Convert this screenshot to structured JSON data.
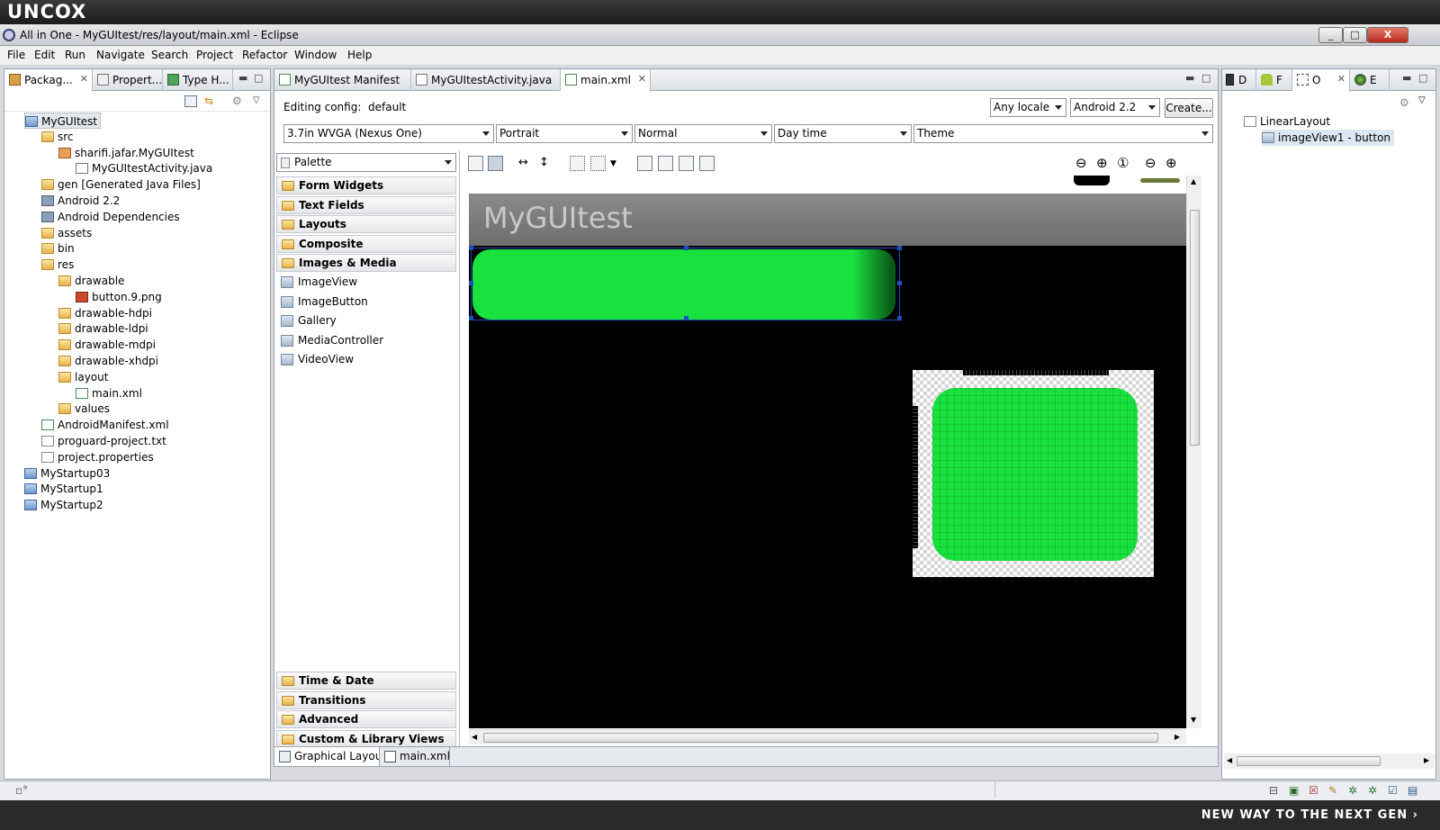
{
  "watermark": {
    "logo": "UNCOX",
    "footer": "NEW WAY TO THE NEXT GEN ›"
  },
  "window": {
    "title": "All in One - MyGUItest/res/layout/main.xml - Eclipse",
    "minimize": "_",
    "maximize": "□",
    "close": "X"
  },
  "menu": [
    "File",
    "Edit",
    "Run",
    "Navigate",
    "Search",
    "Project",
    "Refactor",
    "Window",
    "Help"
  ],
  "left_panel": {
    "tabs": [
      "Packag...",
      "Propert...",
      "Type H..."
    ],
    "tree": [
      {
        "label": "MyGUItest",
        "depth": 0,
        "icon": "project-icon"
      },
      {
        "label": "src",
        "depth": 1,
        "icon": "folder-icon"
      },
      {
        "label": "sharifi.jafar.MyGUItest",
        "depth": 2,
        "icon": "package-icon"
      },
      {
        "label": "MyGUItestActivity.java",
        "depth": 3,
        "icon": "java-file-icon"
      },
      {
        "label": "gen [Generated Java Files]",
        "depth": 1,
        "icon": "folder-icon"
      },
      {
        "label": "Android 2.2",
        "depth": 1,
        "icon": "library-icon"
      },
      {
        "label": "Android Dependencies",
        "depth": 1,
        "icon": "library-icon"
      },
      {
        "label": "assets",
        "depth": 1,
        "icon": "folder-icon"
      },
      {
        "label": "bin",
        "depth": 1,
        "icon": "folder-icon"
      },
      {
        "label": "res",
        "depth": 1,
        "icon": "folder-icon"
      },
      {
        "label": "drawable",
        "depth": 2,
        "icon": "folder-icon"
      },
      {
        "label": "button.9.png",
        "depth": 3,
        "icon": "png-file-icon"
      },
      {
        "label": "drawable-hdpi",
        "depth": 2,
        "icon": "folder-icon"
      },
      {
        "label": "drawable-ldpi",
        "depth": 2,
        "icon": "folder-icon"
      },
      {
        "label": "drawable-mdpi",
        "depth": 2,
        "icon": "folder-icon"
      },
      {
        "label": "drawable-xhdpi",
        "depth": 2,
        "icon": "folder-icon"
      },
      {
        "label": "layout",
        "depth": 2,
        "icon": "folder-icon"
      },
      {
        "label": "main.xml",
        "depth": 3,
        "icon": "xml-file-icon"
      },
      {
        "label": "values",
        "depth": 2,
        "icon": "folder-icon"
      },
      {
        "label": "AndroidManifest.xml",
        "depth": 1,
        "icon": "xml-file-icon"
      },
      {
        "label": "proguard-project.txt",
        "depth": 1,
        "icon": "text-file-icon"
      },
      {
        "label": "project.properties",
        "depth": 1,
        "icon": "text-file-icon"
      },
      {
        "label": "MyStartup03",
        "depth": 0,
        "icon": "project-icon"
      },
      {
        "label": "MyStartup1",
        "depth": 0,
        "icon": "project-icon"
      },
      {
        "label": "MyStartup2",
        "depth": 0,
        "icon": "project-icon"
      }
    ]
  },
  "editor": {
    "tabs": [
      "MyGUItest Manifest",
      "MyGUItestActivity.java",
      "main.xml"
    ],
    "config_label": "Editing config:",
    "config_value": "default",
    "locale": "Any locale",
    "api": "Android 2.2",
    "create": "Create...",
    "device": "3.7in WVGA (Nexus One)",
    "orientation": "Portrait",
    "mode": "Normal",
    "time": "Day time",
    "theme": "Theme",
    "palette_title": "Palette",
    "palette_top": [
      "Form Widgets",
      "Text Fields",
      "Layouts",
      "Composite",
      "Images & Media"
    ],
    "palette_items": [
      "ImageView",
      "ImageButton",
      "Gallery",
      "MediaController",
      "VideoView"
    ],
    "palette_bottom": [
      "Time & Date",
      "Transitions",
      "Advanced",
      "Custom & Library Views"
    ],
    "app_title": "MyGUItest",
    "bottom_tabs": [
      "Graphical Layout",
      "main.xml"
    ],
    "colors": {
      "preview_bg": "#000000",
      "action_bar": "#7d7d7d",
      "green": "#19e23e",
      "selection": "#1e4fbf"
    }
  },
  "right_panel": {
    "tabs": [
      "D",
      "F",
      "O",
      "E"
    ],
    "outline": [
      "LinearLayout",
      "imageView1 - button"
    ]
  }
}
